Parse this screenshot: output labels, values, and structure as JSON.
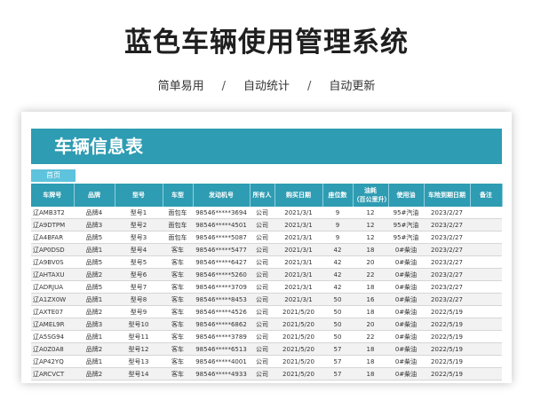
{
  "header": {
    "title": "蓝色车辆使用管理系统",
    "features": [
      "简单易用",
      "自动统计",
      "自动更新"
    ],
    "separator": "/"
  },
  "sheet": {
    "banner_title": "车辆信息表",
    "home_tab": "首页",
    "columns": [
      "车牌号",
      "品牌",
      "型号",
      "车型",
      "发动机号",
      "所有人",
      "购买日期",
      "座位数",
      "油耗\n（百公里升）",
      "使用油",
      "车险到期日期",
      "备注"
    ],
    "rows": [
      [
        "辽AMB3T2",
        "品牌4",
        "型号1",
        "面包车",
        "98546*****3694",
        "公司",
        "2021/3/1",
        "9",
        "12",
        "95#汽油",
        "2023/2/27",
        ""
      ],
      [
        "辽A9DTPM",
        "品牌3",
        "型号2",
        "面包车",
        "98546*****4501",
        "公司",
        "2021/3/1",
        "9",
        "12",
        "95#汽油",
        "2023/2/27",
        ""
      ],
      [
        "辽A4BFAR",
        "品牌5",
        "型号3",
        "面包车",
        "98546*****5087",
        "公司",
        "2021/3/1",
        "9",
        "12",
        "95#汽油",
        "2023/2/27",
        ""
      ],
      [
        "辽AP0DSD",
        "品牌1",
        "型号4",
        "客车",
        "98546*****5477",
        "公司",
        "2021/3/1",
        "42",
        "18",
        "0#柴油",
        "2023/2/27",
        ""
      ],
      [
        "辽A9BV0S",
        "品牌5",
        "型号5",
        "客车",
        "98546*****6427",
        "公司",
        "2021/3/1",
        "42",
        "20",
        "0#柴油",
        "2023/2/27",
        ""
      ],
      [
        "辽AHTAXU",
        "品牌2",
        "型号6",
        "客车",
        "98546*****5260",
        "公司",
        "2021/3/1",
        "42",
        "22",
        "0#柴油",
        "2023/2/27",
        ""
      ],
      [
        "辽ADRJUA",
        "品牌5",
        "型号7",
        "客车",
        "98546*****3709",
        "公司",
        "2021/3/1",
        "42",
        "18",
        "0#柴油",
        "2023/2/27",
        ""
      ],
      [
        "辽A1ZX0W",
        "品牌1",
        "型号8",
        "客车",
        "98546*****8453",
        "公司",
        "2021/3/1",
        "50",
        "16",
        "0#柴油",
        "2023/2/27",
        ""
      ],
      [
        "辽AXTE07",
        "品牌2",
        "型号9",
        "客车",
        "98546*****4526",
        "公司",
        "2021/5/20",
        "50",
        "18",
        "0#柴油",
        "2022/5/19",
        ""
      ],
      [
        "辽AMEL9R",
        "品牌3",
        "型号10",
        "客车",
        "98546*****6862",
        "公司",
        "2021/5/20",
        "50",
        "20",
        "0#柴油",
        "2022/5/19",
        ""
      ],
      [
        "辽A5SG94",
        "品牌1",
        "型号11",
        "客车",
        "98546*****3789",
        "公司",
        "2021/5/20",
        "50",
        "22",
        "0#柴油",
        "2022/5/19",
        ""
      ],
      [
        "辽A0Z0A8",
        "品牌2",
        "型号12",
        "客车",
        "98546*****6513",
        "公司",
        "2021/5/20",
        "57",
        "18",
        "0#柴油",
        "2022/5/19",
        ""
      ],
      [
        "辽AP42YQ",
        "品牌1",
        "型号13",
        "客车",
        "98546*****4001",
        "公司",
        "2021/5/20",
        "57",
        "18",
        "0#柴油",
        "2022/5/19",
        ""
      ],
      [
        "辽ARCVCT",
        "品牌2",
        "型号14",
        "客车",
        "98546*****4933",
        "公司",
        "2021/5/20",
        "57",
        "18",
        "0#柴油",
        "2022/5/19",
        ""
      ]
    ]
  },
  "colors": {
    "header_blue": "#2e9cb2",
    "tab_blue": "#5ec3dc"
  }
}
